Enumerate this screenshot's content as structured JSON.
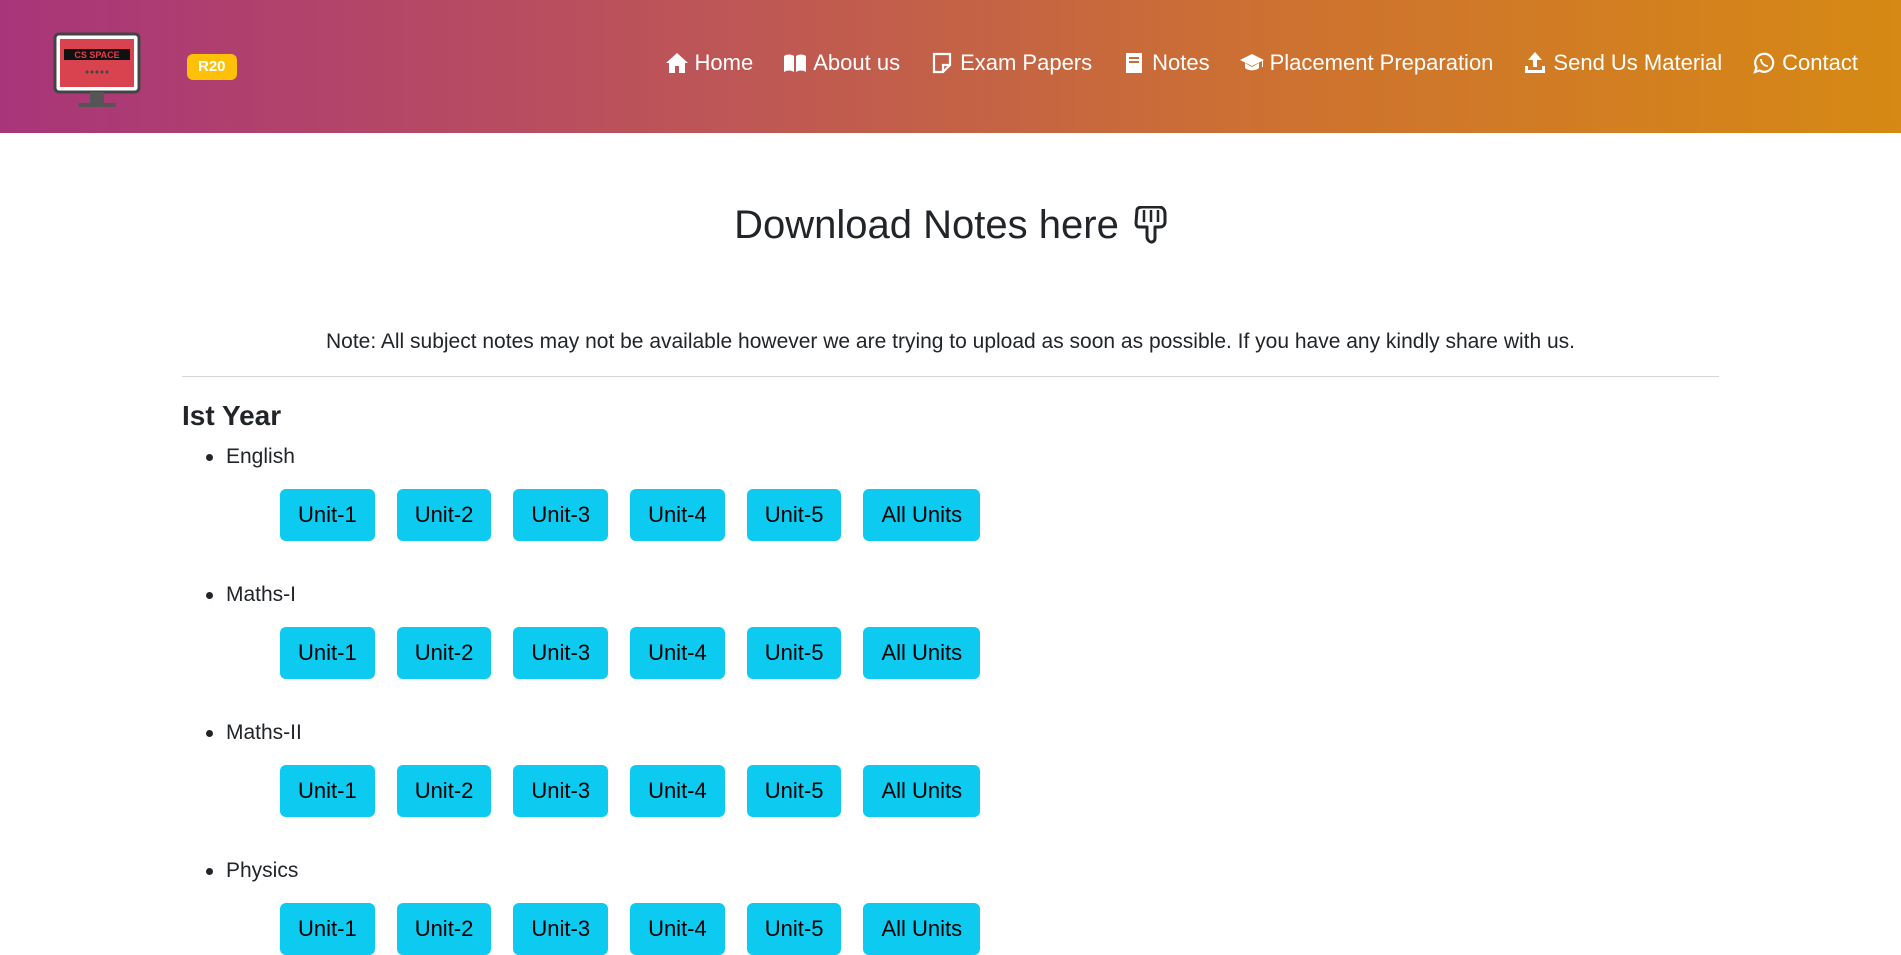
{
  "header": {
    "logo_text": "CS SPACE",
    "badge": "R20",
    "gradient": [
      "#a8357a",
      "#d68914"
    ],
    "nav": [
      {
        "label": "Home",
        "icon": "home-icon"
      },
      {
        "label": "About us",
        "icon": "book-open-icon"
      },
      {
        "label": "Exam Papers",
        "icon": "sticky-note-icon"
      },
      {
        "label": "Notes",
        "icon": "book-icon"
      },
      {
        "label": "Placement Preparation",
        "icon": "graduation-cap-icon"
      },
      {
        "label": "Send Us Material",
        "icon": "upload-icon"
      },
      {
        "label": "Contact",
        "icon": "whatsapp-icon"
      }
    ]
  },
  "main": {
    "title": "Download Notes here",
    "title_icon": "pointing-down-hand-icon",
    "note": "Note: All subject notes may not be available however we are trying to upload as soon as possible. If you have any kindly share with us.",
    "year": "Ist Year",
    "accent_color": "#0dcaf0",
    "subjects": [
      {
        "name": "English",
        "buttons": [
          "Unit-1",
          "Unit-2",
          "Unit-3",
          "Unit-4",
          "Unit-5",
          "All Units"
        ]
      },
      {
        "name": "Maths-I",
        "buttons": [
          "Unit-1",
          "Unit-2",
          "Unit-3",
          "Unit-4",
          "Unit-5",
          "All Units"
        ]
      },
      {
        "name": "Maths-II",
        "buttons": [
          "Unit-1",
          "Unit-2",
          "Unit-3",
          "Unit-4",
          "Unit-5",
          "All Units"
        ]
      },
      {
        "name": "Physics",
        "buttons": [
          "Unit-1",
          "Unit-2",
          "Unit-3",
          "Unit-4",
          "Unit-5",
          "All Units"
        ]
      }
    ]
  }
}
